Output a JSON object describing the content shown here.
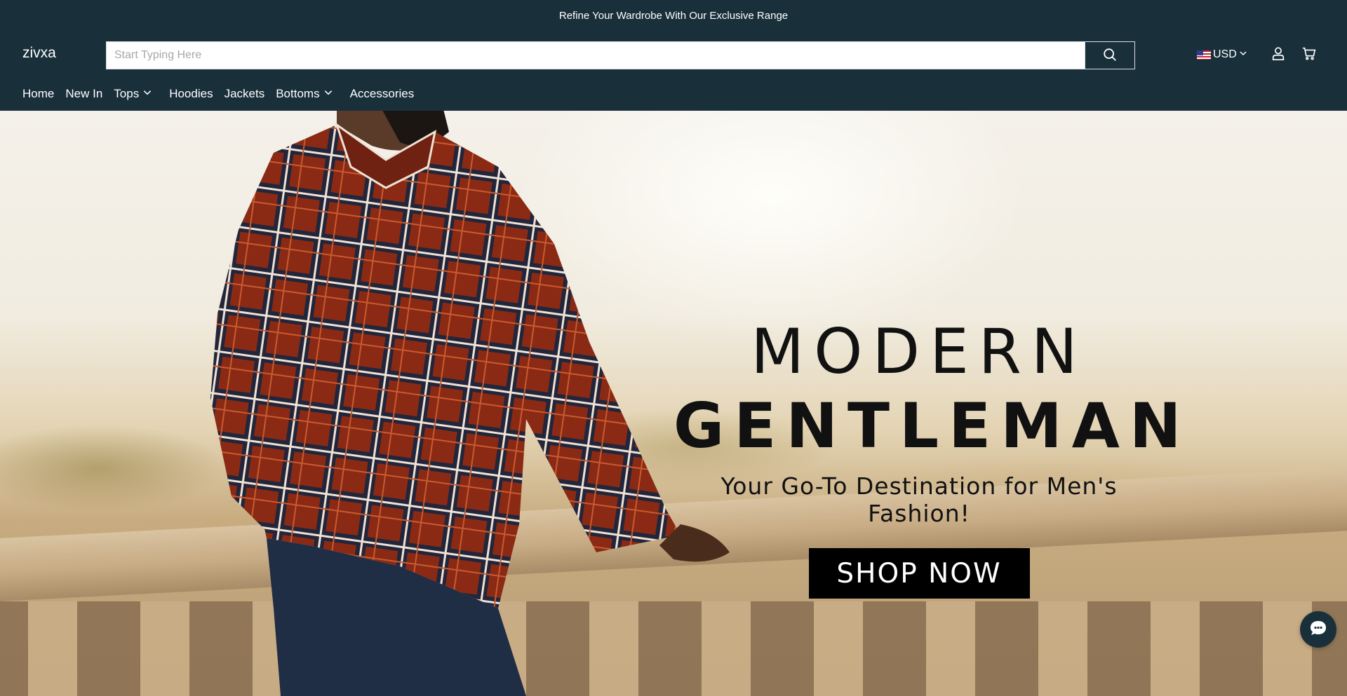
{
  "announcement": {
    "text": "Refine Your Wardrobe With Our Exclusive Range"
  },
  "header": {
    "logo": "zivxa",
    "search": {
      "placeholder": "Start Typing Here",
      "value": ""
    },
    "currency": {
      "code": "USD",
      "flag_icon": "us-flag-icon"
    }
  },
  "nav": {
    "items": [
      {
        "label": "Home",
        "has_dropdown": false
      },
      {
        "label": "New In",
        "has_dropdown": false
      },
      {
        "label": "Tops",
        "has_dropdown": true
      },
      {
        "label": "Hoodies",
        "has_dropdown": false
      },
      {
        "label": "Jackets",
        "has_dropdown": false
      },
      {
        "label": "Bottoms",
        "has_dropdown": true
      },
      {
        "label": "Accessories",
        "has_dropdown": false
      }
    ]
  },
  "hero": {
    "title_line1": "MODERN",
    "title_line2": "GENTLEMAN",
    "subtitle": "Your Go-To Destination for Men's Fashion!",
    "cta_label": "SHOP NOW"
  },
  "colors": {
    "header_bg": "#19303b",
    "cta_bg": "#000000",
    "cta_text": "#ffffff"
  },
  "icons": [
    "search-icon",
    "chevron-down-icon",
    "user-icon",
    "cart-icon",
    "chat-icon"
  ]
}
